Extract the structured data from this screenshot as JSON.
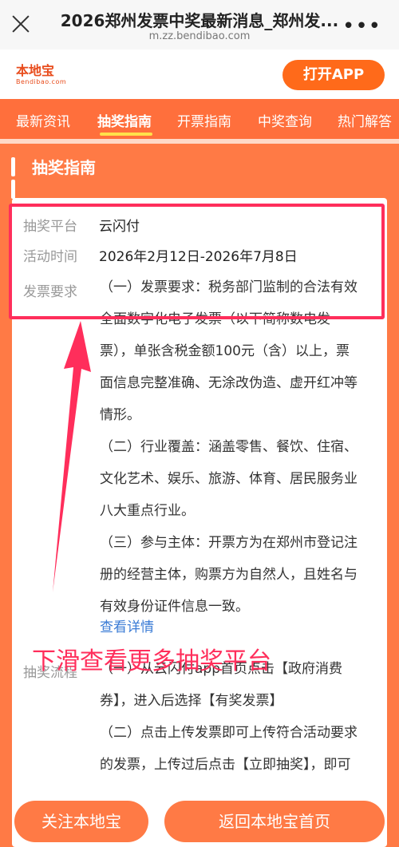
{
  "browser": {
    "title": "2026郑州发票中奖最新消息_郑州发...",
    "url": "m.zz.bendibao.com"
  },
  "header": {
    "logo_text": "本地宝",
    "logo_sub": "Bendibao.com",
    "open_app": "打开APP"
  },
  "tabs": [
    "最新资讯",
    "抽奖指南",
    "开票指南",
    "中奖查询",
    "热门解答"
  ],
  "section": {
    "title": "抽奖指南"
  },
  "info": {
    "platform_label": "抽奖平台",
    "platform_value": "云闪付",
    "time_label": "活动时间",
    "time_value": "2026年2月12日-2026年7月8日",
    "req_label": "发票要求",
    "req_line1": "（一）发票要求：税务部门监制的合法有效",
    "req_line2": "全面数字化电子发票（以下简称数电发",
    "req_line3": "票），单张含税金额100元（含）以上，票",
    "req_line4": "面信息完整准确、无涂改伪造、虚开红冲等",
    "req_line5": "情形。",
    "ind_line1": "（二）行业覆盖：涵盖零售、餐饮、住宿、",
    "ind_line2": "文化艺术、娱乐、旅游、体育、居民服务业",
    "ind_line3": "八大重点行业。",
    "sub_line1": "（三）参与主体：开票方为在郑州市登记注",
    "sub_line2": "册的经营主体，购票方为自然人，且姓名与",
    "sub_line3": "有效身份证件信息一致。",
    "detail_link": "查看详情",
    "flow_label": "抽奖流程",
    "flow_line1": "（一）从云闪付app首页点击【政府消费",
    "flow_line2": "券】，进入后选择【有奖发票】",
    "flow_line3": "（二）点击上传发票即可上传符合活动要求",
    "flow_line4": "的发票，上传过后点击【立即抽奖】，即可"
  },
  "overlay": {
    "caption": "下滑查看更多抽奖平台"
  },
  "bottom": {
    "follow": "关注本地宝",
    "home": "返回本地宝首页"
  },
  "colors": {
    "accent": "#ff7a45",
    "highlight": "#ff2e5b",
    "link": "#3a7bd5"
  }
}
